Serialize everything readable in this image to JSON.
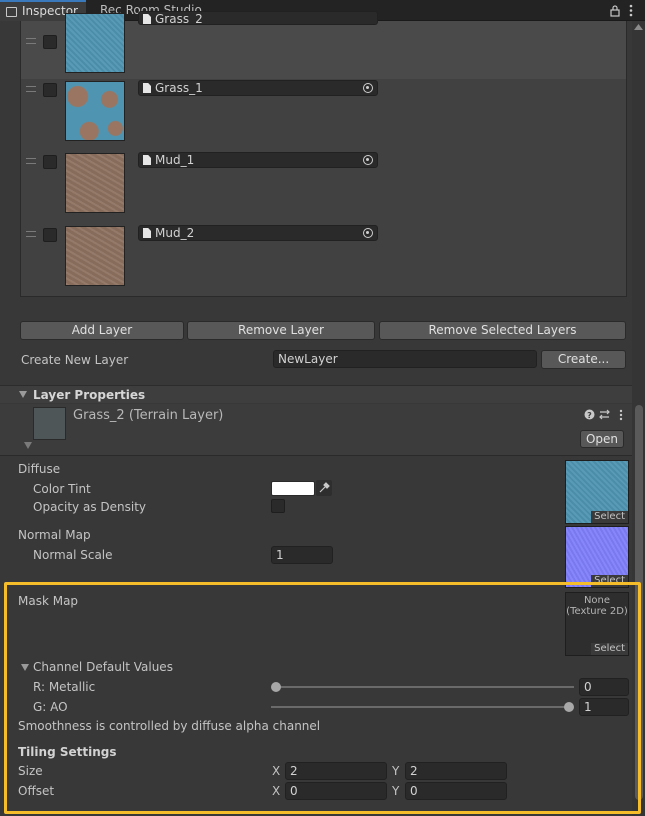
{
  "tabs": [
    {
      "label": "Inspector",
      "active": true
    },
    {
      "label": "Rec Room Studio",
      "active": false
    }
  ],
  "layers": [
    {
      "name": "Grass_2",
      "texture": "blue",
      "selected": true
    },
    {
      "name": "Grass_1",
      "texture": "grass"
    },
    {
      "name": "Mud_1",
      "texture": "mud"
    },
    {
      "name": "Mud_2",
      "texture": "mud"
    }
  ],
  "buttons": {
    "add_layer": "Add Layer",
    "remove_layer": "Remove Layer",
    "remove_selected": "Remove Selected Layers",
    "create": "Create...",
    "open": "Open"
  },
  "create_new_layer": {
    "label": "Create New Layer",
    "value": "NewLayer"
  },
  "layer_properties": {
    "title": "Layer Properties",
    "asset_name": "Grass_2 (Terrain Layer)"
  },
  "diffuse": {
    "label": "Diffuse",
    "color_tint_label": "Color Tint",
    "color_tint": "#ffffff",
    "opacity_label": "Opacity as Density",
    "opacity_checked": false
  },
  "normal_map": {
    "label": "Normal Map",
    "scale_label": "Normal Scale",
    "scale_value": "1"
  },
  "texture_slots": {
    "select_label": "Select"
  },
  "mask_map": {
    "label": "Mask Map",
    "none_line1": "None",
    "none_line2": "(Texture 2D)"
  },
  "channel_defaults": {
    "label": "Channel Default Values",
    "metallic_label": "R: Metallic",
    "metallic_value": "0",
    "metallic_fraction": 0,
    "ao_label": "G: AO",
    "ao_value": "1",
    "ao_fraction": 1
  },
  "smoothness_note": "Smoothness is controlled by diffuse alpha channel",
  "tiling": {
    "title": "Tiling Settings",
    "size_label": "Size",
    "offset_label": "Offset",
    "x_label": "X",
    "y_label": "Y",
    "size_x": "2",
    "size_y": "2",
    "offset_x": "0",
    "offset_y": "0"
  },
  "colors": {
    "highlight": "#f5bd29",
    "accent": "#3a79bb",
    "panel_bg": "#383838"
  }
}
